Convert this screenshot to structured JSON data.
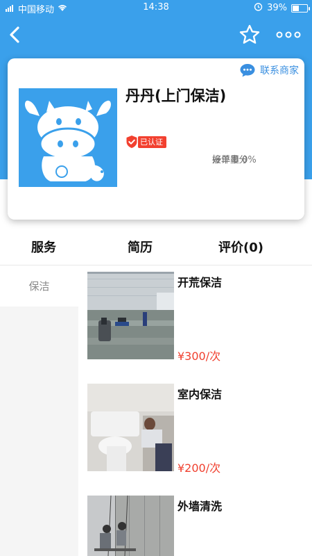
{
  "status_bar": {
    "carrier": "中国移动",
    "time": "14:38",
    "battery": "39%",
    "battery_level": 0.39
  },
  "nav": {
    "back_icon": "chevron-left-icon",
    "favorite_icon": "star-outline-icon",
    "more_icon": "more-dots-icon"
  },
  "shop": {
    "contact_label": "联系商家",
    "name": "丹丹(上门保洁)",
    "verified_label": "已认证",
    "stats": {
      "good_review": "好评 0分",
      "accept_rate": "接单率 0%",
      "order_count": "接单量 0"
    }
  },
  "tabs": [
    {
      "label": "服务"
    },
    {
      "label": "简历"
    },
    {
      "label": "评价(0)"
    }
  ],
  "sidebar": {
    "categories": [
      {
        "label": "保洁"
      }
    ]
  },
  "services": [
    {
      "title": "开荒保洁",
      "price": "¥300/次"
    },
    {
      "title": "室内保洁",
      "price": "¥200/次"
    },
    {
      "title": "外墙清洗",
      "price": ""
    }
  ],
  "colors": {
    "brand": "#3aa0eb",
    "price": "#f0402f",
    "verified": "#f2402f"
  }
}
